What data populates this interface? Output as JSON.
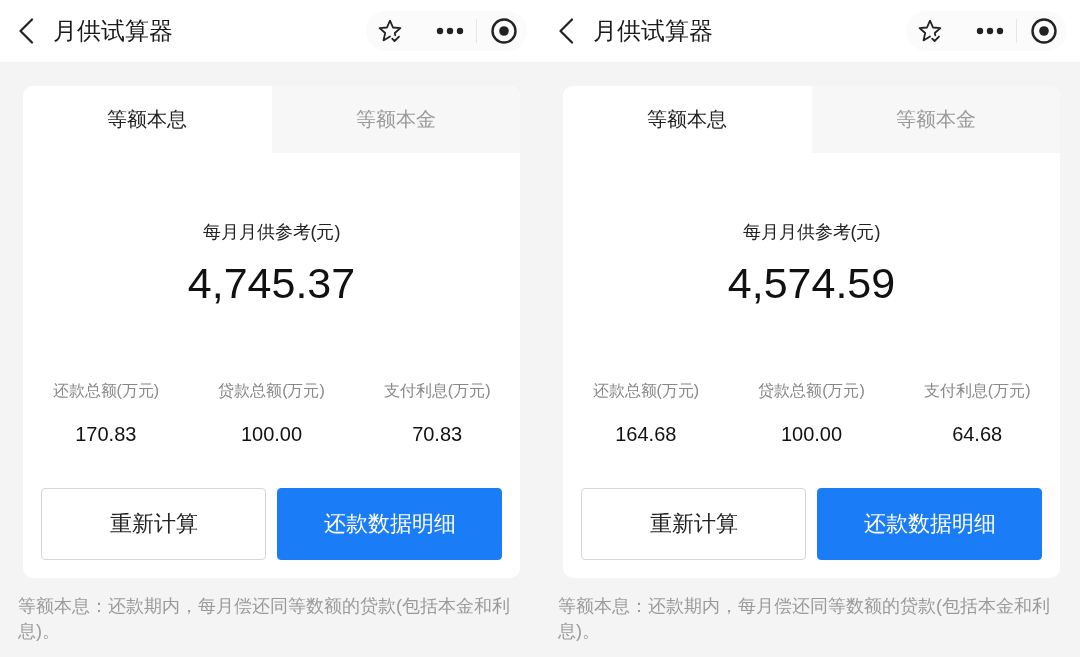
{
  "screens": [
    {
      "nav_bar": {
        "title": "月供试算器"
      },
      "tabs": [
        {
          "label": "等额本息",
          "selected": true
        },
        {
          "label": "等额本金",
          "selected": false
        }
      ],
      "summary": {
        "label": "每月月供参考(元)",
        "amount": "4,745.37"
      },
      "stats": [
        {
          "label": "还款总额(万元)",
          "value": "170.83"
        },
        {
          "label": "贷款总额(万元)",
          "value": "100.00"
        },
        {
          "label": "支付利息(万元)",
          "value": "70.83"
        }
      ],
      "buttons": [
        {
          "label": "重新计算",
          "kind": "outline"
        },
        {
          "label": "还款数据明细",
          "kind": "primary"
        }
      ],
      "note": "等额本息：还款期内，每月偿还同等数额的贷款(包括本金和利息)。"
    },
    {
      "nav_bar": {
        "title": "月供试算器"
      },
      "tabs": [
        {
          "label": "等额本息",
          "selected": true
        },
        {
          "label": "等额本金",
          "selected": false
        }
      ],
      "summary": {
        "label": "每月月供参考(元)",
        "amount": "4,574.59"
      },
      "stats": [
        {
          "label": "还款总额(万元)",
          "value": "164.68"
        },
        {
          "label": "贷款总额(万元)",
          "value": "100.00"
        },
        {
          "label": "支付利息(万元)",
          "value": "64.68"
        }
      ],
      "buttons": [
        {
          "label": "重新计算",
          "kind": "outline"
        },
        {
          "label": "还款数据明细",
          "kind": "primary"
        }
      ],
      "note": "等额本息：还款期内，每月偿还同等数额的贷款(包括本金和利息)。"
    }
  ]
}
